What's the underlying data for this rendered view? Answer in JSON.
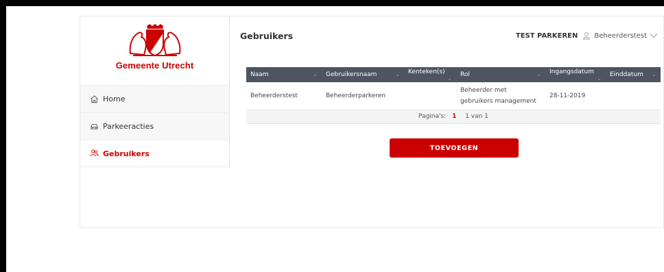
{
  "brand": {
    "name": "Gemeente Utrecht",
    "color": "#cc0000"
  },
  "sidebar": {
    "items": [
      {
        "label": "Home",
        "icon": "home-icon"
      },
      {
        "label": "Parkeeracties",
        "icon": "car-icon"
      },
      {
        "label": "Gebruikers",
        "icon": "users-icon",
        "active": true
      }
    ]
  },
  "header": {
    "title": "Gebruikers",
    "company": "TEST PARKEREN",
    "user": "Beheerderstest"
  },
  "table": {
    "columns": [
      "Naam",
      "Gebruikersnaam",
      "Kenteken(s)",
      "Rol",
      "Ingangsdatum",
      "Einddatum"
    ],
    "rows": [
      [
        "Beheerderstest",
        "Beheerderparkeren",
        "",
        "Beheerder met gebruikers management",
        "28-11-2019",
        ""
      ]
    ],
    "pager_label": "Pagina's:",
    "pager_current": "1",
    "pager_total": "1 van 1"
  },
  "actions": {
    "add_label": "TOEVOEGEN"
  }
}
